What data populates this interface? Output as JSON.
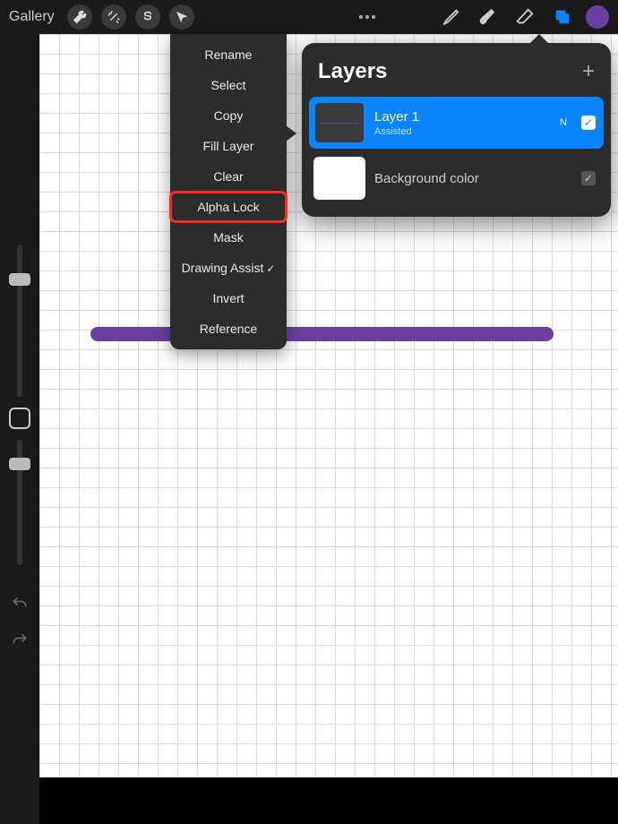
{
  "topbar": {
    "gallery": "Gallery"
  },
  "context_menu": {
    "items": [
      "Rename",
      "Select",
      "Copy",
      "Fill Layer",
      "Clear",
      "Alpha Lock",
      "Mask",
      "Drawing Assist",
      "Invert",
      "Reference"
    ],
    "highlighted": "Alpha Lock",
    "checked": "Drawing Assist"
  },
  "layers_panel": {
    "title": "Layers",
    "layer1": {
      "name": "Layer 1",
      "subtitle": "Assisted",
      "badge": "N"
    },
    "background": {
      "name": "Background color"
    }
  },
  "colors": {
    "accent": "#0a84ff",
    "brush": "#6b3fa0",
    "highlight_box": "#ff2a1a"
  },
  "icons": {
    "wrench": "wrench-icon",
    "wand": "wand-icon",
    "select": "select-s-icon",
    "move": "arrow-icon",
    "more": "dots-icon",
    "brush": "brush-icon",
    "smudge": "smudge-icon",
    "eraser": "eraser-icon",
    "layers": "layers-icon",
    "color": "color-swatch"
  }
}
